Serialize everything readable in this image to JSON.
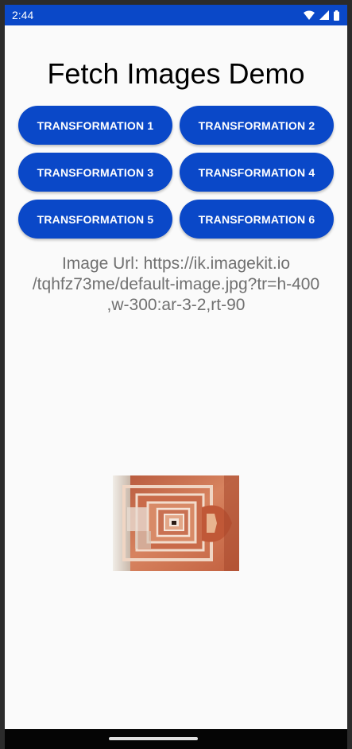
{
  "status_bar": {
    "time": "2:44",
    "icons": [
      "wifi-icon",
      "signal-icon",
      "battery-icon"
    ],
    "background": "#0a48c8"
  },
  "app": {
    "title": "Fetch Images Demo"
  },
  "buttons": [
    {
      "label": "TRANSFORMATION 1"
    },
    {
      "label": "TRANSFORMATION 2"
    },
    {
      "label": "TRANSFORMATION 3"
    },
    {
      "label": "TRANSFORMATION 4"
    },
    {
      "label": "TRANSFORMATION 5"
    },
    {
      "label": "TRANSFORMATION 6"
    }
  ],
  "image_url": {
    "line1": "Image Url: https://ik.imagekit.io",
    "line2": "/tqhfz73me/default-image.jpg?tr=h-400",
    "line3": ",w-300:ar-3-2,rt-90"
  },
  "colors": {
    "accent": "#0a48c8",
    "background": "#fafafa",
    "url_text": "#707070"
  }
}
